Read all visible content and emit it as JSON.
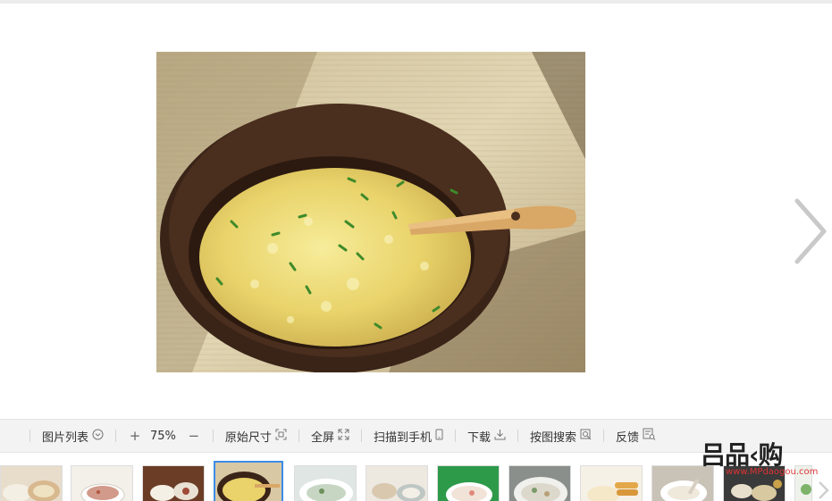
{
  "toolbar": {
    "list_label": "图片列表",
    "zoom_in": "+",
    "zoom_value": "75%",
    "zoom_out": "−",
    "original_size": "原始尺寸",
    "fullscreen": "全屏",
    "scan_to_phone": "扫描到手机",
    "download": "下载",
    "search_by_image": "按图搜索",
    "feedback": "反馈"
  },
  "watermark": {
    "brand": "吕品‹购",
    "url": "www.MPdaogou.com"
  },
  "icons": {
    "next": "chevron-right-icon",
    "list": "chevron-circle-icon",
    "original": "crop-frame-icon",
    "fullscreen": "expand-icon",
    "phone": "phone-icon",
    "download": "download-icon",
    "search": "search-image-icon",
    "feedback": "feedback-icon"
  },
  "colors": {
    "accent": "#3d8be8",
    "toolbar_bg": "#f3f3f3",
    "watermark_red": "#dd3333"
  }
}
